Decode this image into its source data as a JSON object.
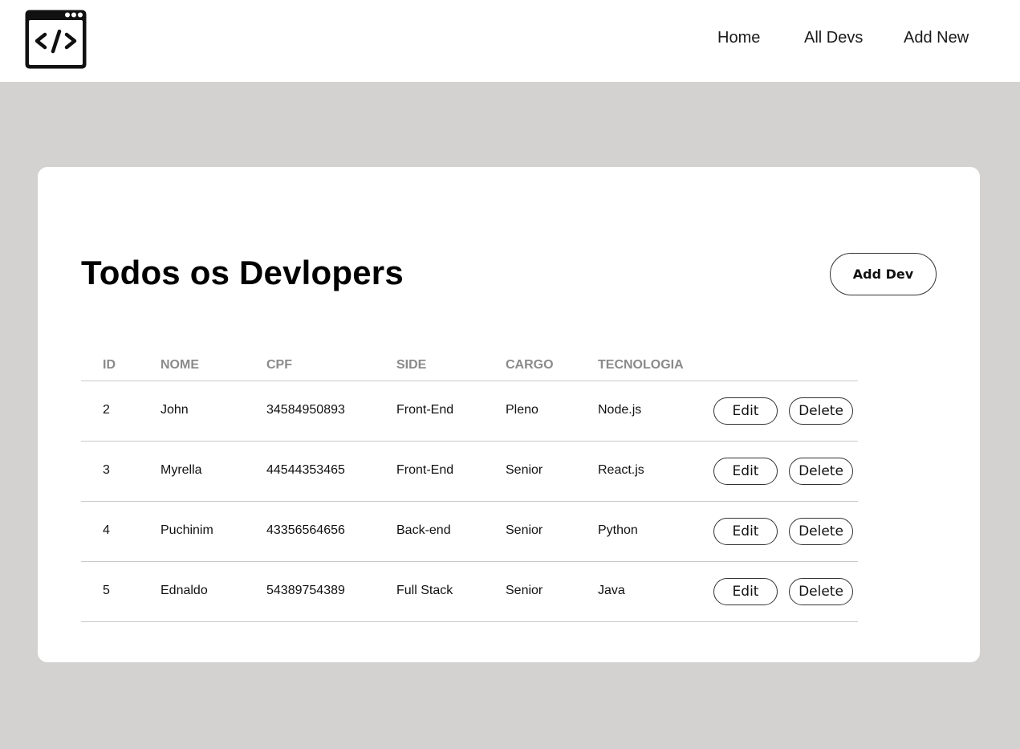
{
  "nav": {
    "logo_icon": "code-window-icon",
    "items": [
      "Home",
      "All Devs",
      "Add New"
    ]
  },
  "main": {
    "title": "Todos os Devlopers",
    "add_button": "Add Dev"
  },
  "table": {
    "headers": [
      "ID",
      "NOME",
      "CPF",
      "SIDE",
      "CARGO",
      "TECNOLOGIA"
    ],
    "rows": [
      {
        "id": "2",
        "nome": "John",
        "cpf": "34584950893",
        "side": "Front-End",
        "cargo": "Pleno",
        "tecnologia": "Node.js"
      },
      {
        "id": "3",
        "nome": "Myrella",
        "cpf": "44544353465",
        "side": "Front-End",
        "cargo": "Senior",
        "tecnologia": "React.js"
      },
      {
        "id": "4",
        "nome": "Puchinim",
        "cpf": "43356564656",
        "side": "Back-end",
        "cargo": "Senior",
        "tecnologia": "Python"
      },
      {
        "id": "5",
        "nome": "Ednaldo",
        "cpf": "54389754389",
        "side": "Full Stack",
        "cargo": "Senior",
        "tecnologia": "Java"
      }
    ],
    "edit_label": "Edit",
    "delete_label": "Delete"
  },
  "colors": {
    "page_background": "#d3d2d0",
    "card_background": "#ffffff",
    "header_text": "#8a8a8a"
  }
}
